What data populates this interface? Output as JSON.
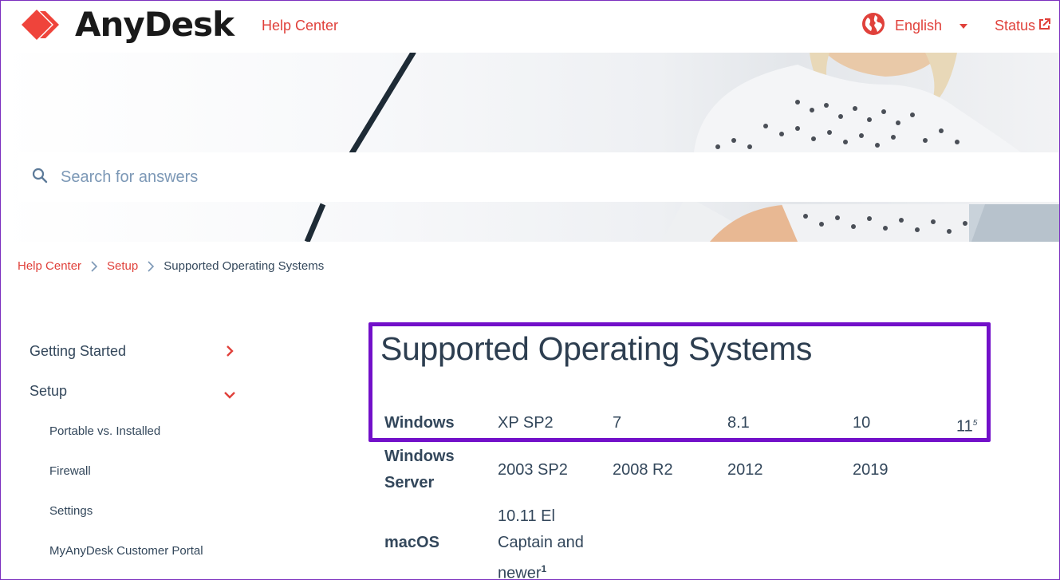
{
  "header": {
    "brand": "AnyDesk",
    "help_center": "Help Center",
    "language": "English",
    "status": "Status"
  },
  "search": {
    "placeholder": "Search for answers"
  },
  "breadcrumb": {
    "items": [
      "Help Center",
      "Setup"
    ],
    "current": "Supported Operating Systems"
  },
  "sidebar": {
    "sections": [
      {
        "label": "Getting Started",
        "state": "collapsed"
      },
      {
        "label": "Setup",
        "state": "expanded"
      }
    ],
    "sub_items": [
      "Portable vs. Installed",
      "Firewall",
      "Settings",
      "MyAnyDesk Customer Portal"
    ]
  },
  "main": {
    "title": "Supported Operating Systems",
    "rows": [
      {
        "os": "Windows",
        "versions": [
          "XP SP2",
          "7",
          "8.1",
          "10",
          "11"
        ],
        "footnote": "5"
      },
      {
        "os_lines": [
          "Windows",
          "Server"
        ],
        "versions": [
          "2003 SP2",
          "2008 R2",
          "2012",
          "2019"
        ]
      },
      {
        "os": "macOS",
        "version_lines": [
          "10.11 El",
          "Captain and",
          "newer"
        ],
        "footnote": "1"
      }
    ]
  },
  "colors": {
    "brand_red": "#e0413b",
    "text": "#33475b",
    "highlight": "#7210c9"
  },
  "icons": [
    "anydesk-logo-icon",
    "globe-icon",
    "caret-down-icon",
    "external-link-icon",
    "search-icon",
    "chevron-right-icon",
    "chevron-down-icon"
  ]
}
